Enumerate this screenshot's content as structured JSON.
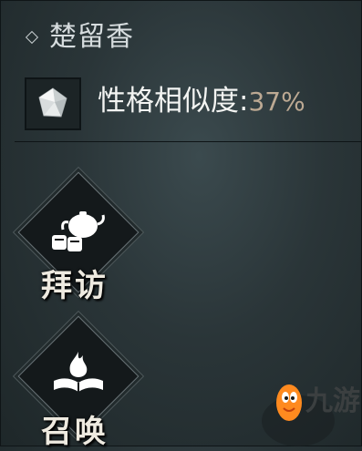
{
  "character": {
    "name": "楚留香"
  },
  "similarity": {
    "label": "性格相似度:",
    "value": "37%"
  },
  "actions": [
    {
      "label": "拜访",
      "icon": "teapot-icon"
    },
    {
      "label": "召唤",
      "icon": "flame-book-icon"
    }
  ],
  "watermark": {
    "text": "九游"
  },
  "colors": {
    "background": "#2a3538",
    "percent": "#bca993",
    "text": "#f3f4f2"
  }
}
